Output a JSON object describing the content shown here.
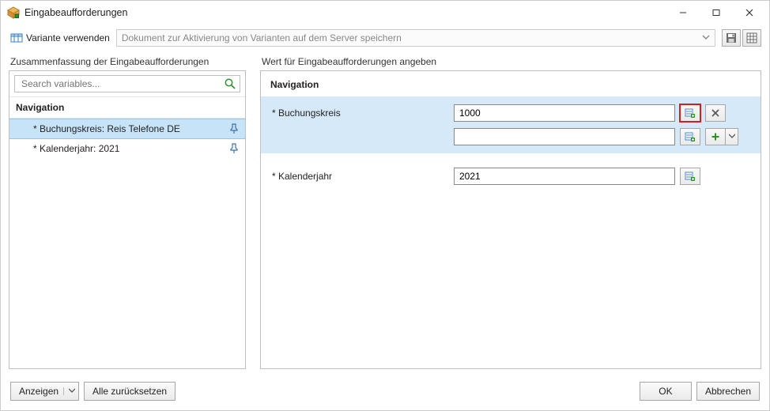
{
  "window": {
    "title": "Eingabeaufforderungen"
  },
  "toolbar": {
    "variant_label": "Variante verwenden",
    "variant_placeholder": "Dokument zur Aktivierung von Varianten auf dem Server speichern"
  },
  "left": {
    "summary_header": "Zusammenfassung der Eingabeaufforderungen",
    "search_placeholder": "Search variables...",
    "group": "Navigation",
    "items": [
      {
        "label": "* Buchungskreis: Reis Telefone DE",
        "selected": true
      },
      {
        "label": "* Kalenderjahr: 2021",
        "selected": false
      }
    ]
  },
  "right": {
    "header": "Wert für Eingabeaufforderungen angeben",
    "section": "Navigation",
    "prompts": {
      "buchungskreis_label": "* Buchungskreis",
      "buchungskreis_value": "1000",
      "buchungskreis_value2": "",
      "kalenderjahr_label": "* Kalenderjahr",
      "kalenderjahr_value": "2021"
    }
  },
  "footer": {
    "display": "Anzeigen",
    "reset_all": "Alle zurücksetzen",
    "ok": "OK",
    "cancel": "Abbrechen"
  }
}
